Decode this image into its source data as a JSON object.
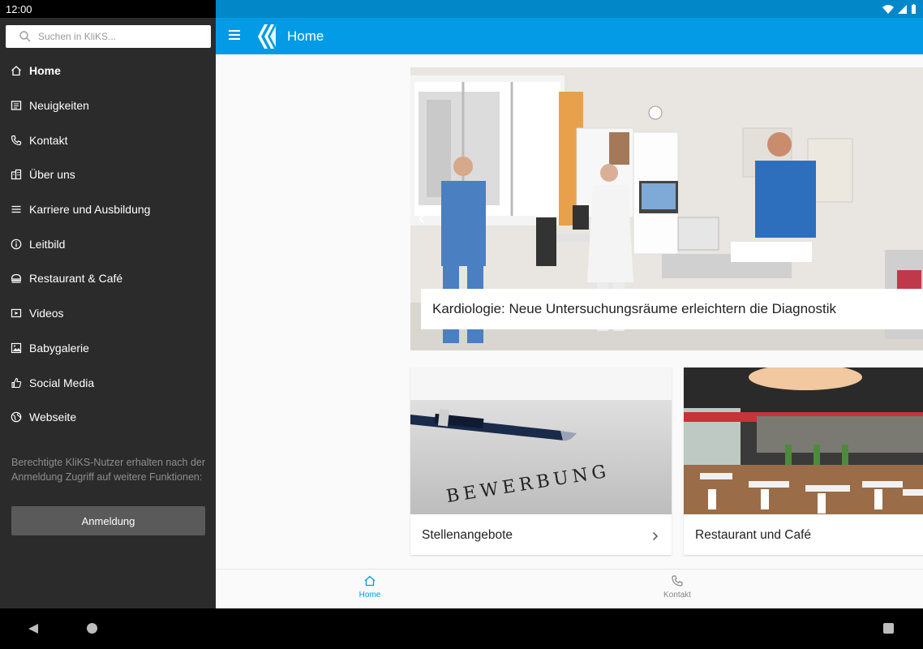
{
  "status_bar": {
    "time": "12:00"
  },
  "search": {
    "placeholder": "Suchen in KliKS..."
  },
  "menu": {
    "items": [
      {
        "label": "Home",
        "icon": "home-icon",
        "active": true
      },
      {
        "label": "Neuigkeiten",
        "icon": "news-icon"
      },
      {
        "label": "Kontakt",
        "icon": "phone-icon"
      },
      {
        "label": "Über uns",
        "icon": "building-icon"
      },
      {
        "label": "Karriere und Ausbildung",
        "icon": "list-icon"
      },
      {
        "label": "Leitbild",
        "icon": "info-icon"
      },
      {
        "label": "Restaurant & Café",
        "icon": "restaurant-icon"
      },
      {
        "label": "Videos",
        "icon": "video-icon"
      },
      {
        "label": "Babygalerie",
        "icon": "gallery-icon"
      },
      {
        "label": "Social Media",
        "icon": "thumbs-up-icon"
      },
      {
        "label": "Webseite",
        "icon": "globe-icon"
      }
    ]
  },
  "drawer": {
    "note": "Berechtigte KliKS-Nutzer erhalten nach der Anmeldung Zugriff auf weitere Funktionen:",
    "login_label": "Anmeldung"
  },
  "appbar": {
    "title": "Home"
  },
  "hero": {
    "caption": "Kardiologie: Neue Untersuchungsräume erleichtern die Diagnostik"
  },
  "cards": [
    {
      "label": "Stellenangebote",
      "image_text": "BEWERBUNG"
    },
    {
      "label": "Restaurant und Café"
    }
  ],
  "bottom_nav": {
    "home": "Home",
    "kontakt": "Kontakt"
  },
  "colors": {
    "primary": "#039be5",
    "status_bar": "#0287c8",
    "drawer": "#2b2b2b"
  }
}
